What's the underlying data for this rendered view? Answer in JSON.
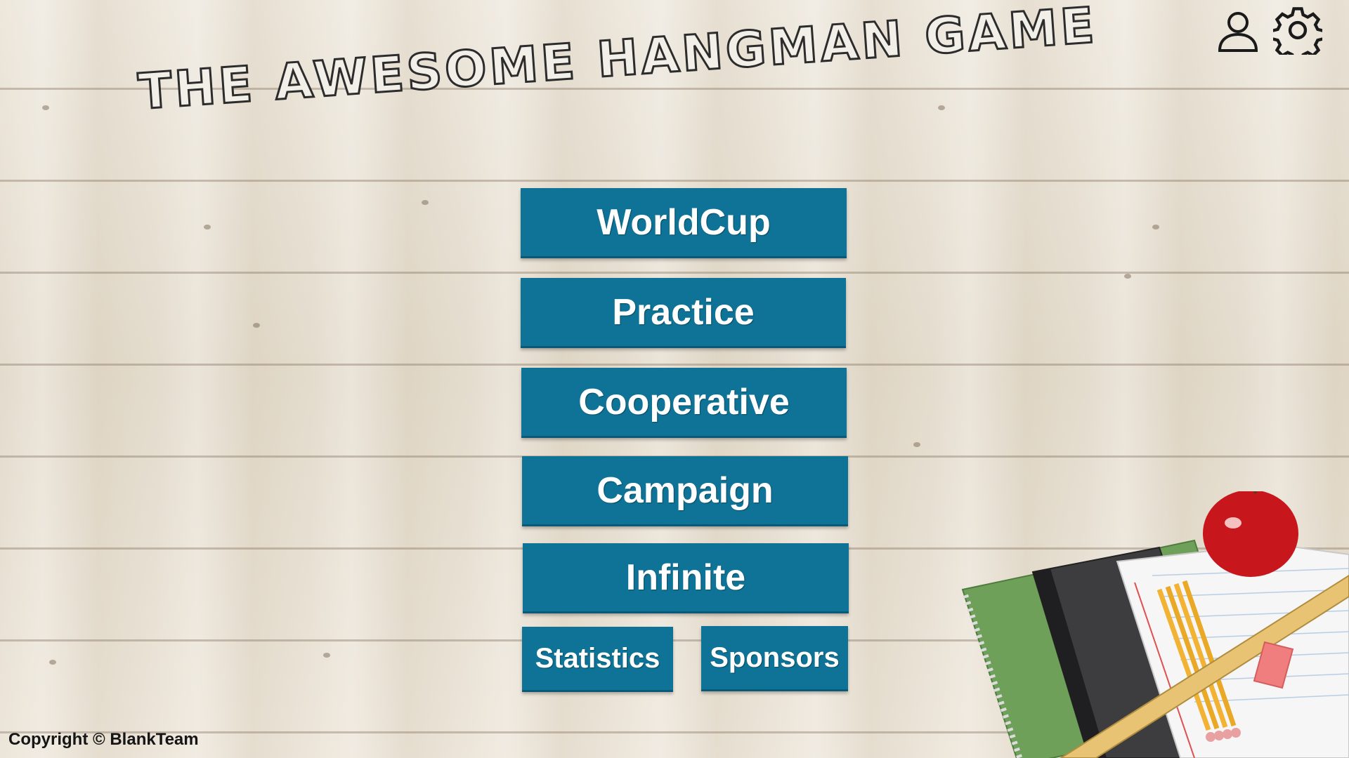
{
  "title": "tHE AwESOME HANGMAN GAME",
  "icons": {
    "profile": "user-icon",
    "settings": "gear-icon"
  },
  "menu": {
    "worldcup": "WorldCup",
    "practice": "Practice",
    "cooperative": "Cooperative",
    "campaign": "Campaign",
    "infinite": "Infinite",
    "statistics": "Statistics",
    "sponsors": "Sponsors"
  },
  "footer": {
    "copyright": "Copyright © BlankTeam"
  },
  "colors": {
    "button": "#0e7396",
    "button_text": "#ffffff",
    "title_stroke": "#2c2c2c"
  }
}
